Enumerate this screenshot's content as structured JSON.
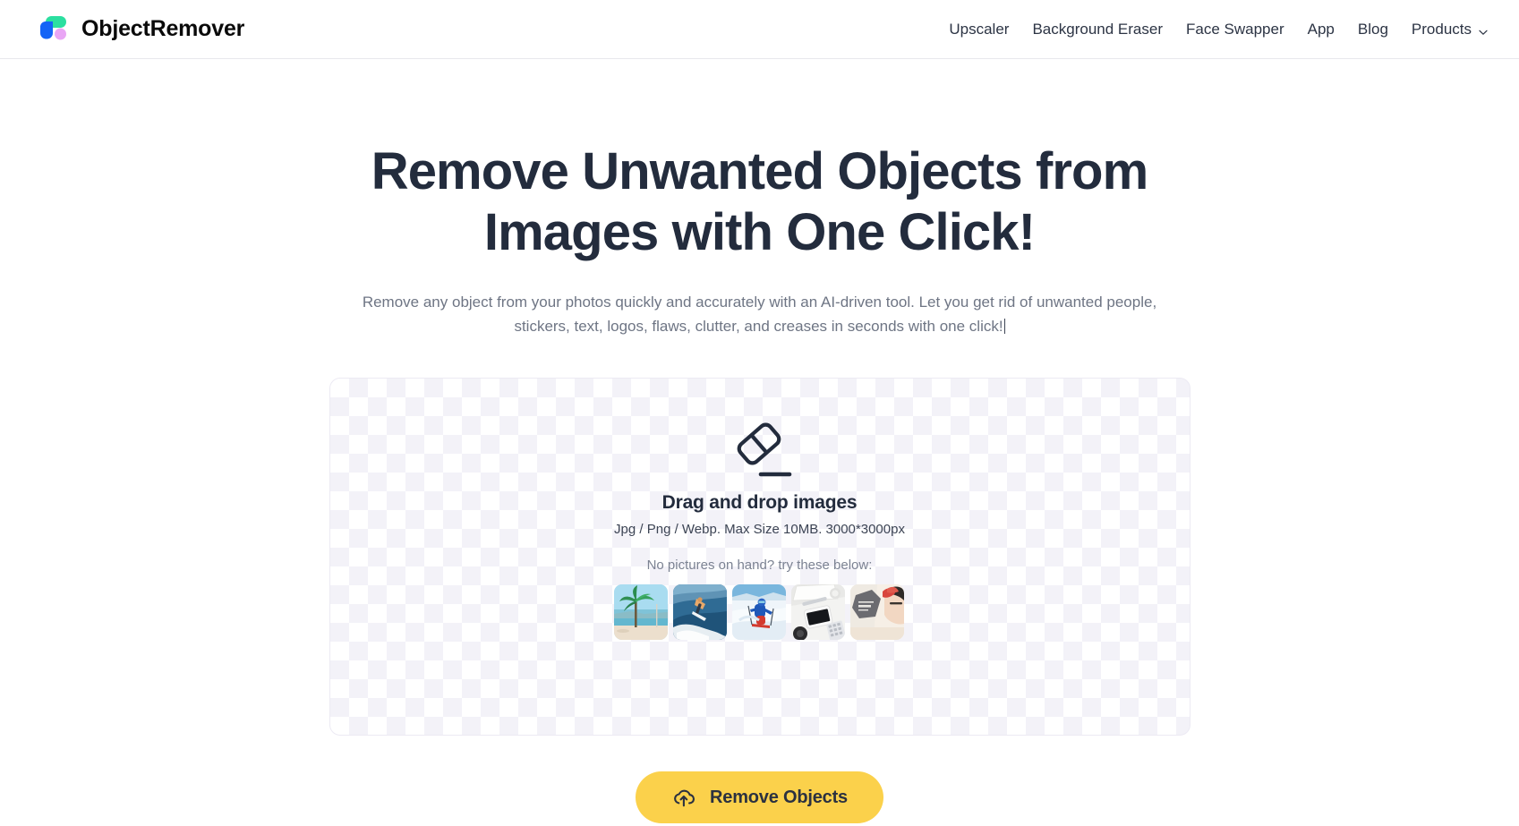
{
  "header": {
    "brand": {
      "name": "ObjectRemover",
      "logo_icon": "objectremover-logo-icon",
      "colors": {
        "green": "#2BDFA0",
        "blue": "#1464F6",
        "pink": "#E9A6F5"
      }
    },
    "nav": [
      {
        "label": "Upscaler",
        "has_dropdown": false
      },
      {
        "label": "Background Eraser",
        "has_dropdown": false
      },
      {
        "label": "Face Swapper",
        "has_dropdown": false
      },
      {
        "label": "App",
        "has_dropdown": false
      },
      {
        "label": "Blog",
        "has_dropdown": false
      },
      {
        "label": "Products",
        "has_dropdown": true,
        "dropdown_icon": "chevron-down-icon"
      }
    ]
  },
  "hero": {
    "title": "Remove Unwanted Objects from Images with One Click!",
    "subtitle": "Remove any object from your photos quickly and accurately with an AI-driven tool. Let you get rid of unwanted people, stickers, text, logos, flaws, clutter, and creases in seconds with one click!"
  },
  "dropzone": {
    "icon": "eraser-icon",
    "title": "Drag and drop images",
    "spec": "Jpg / Png / Webp. Max Size 10MB. 3000*3000px",
    "hint": "No pictures on hand? try these below:",
    "samples": [
      {
        "name": "sample-palm-beach",
        "alt": "Palm tree on a tropical beach"
      },
      {
        "name": "sample-surfer",
        "alt": "Surfer riding a wave"
      },
      {
        "name": "sample-skier",
        "alt": "Skier on a snowy slope"
      },
      {
        "name": "sample-desk-phone",
        "alt": "Smartphone and stationery on a white desk"
      },
      {
        "name": "sample-portrait-text",
        "alt": "Person with hand raised and text overlay"
      }
    ]
  },
  "cta": {
    "label": "Remove Objects",
    "icon": "cloud-upload-icon",
    "color": "#FBD14B"
  }
}
